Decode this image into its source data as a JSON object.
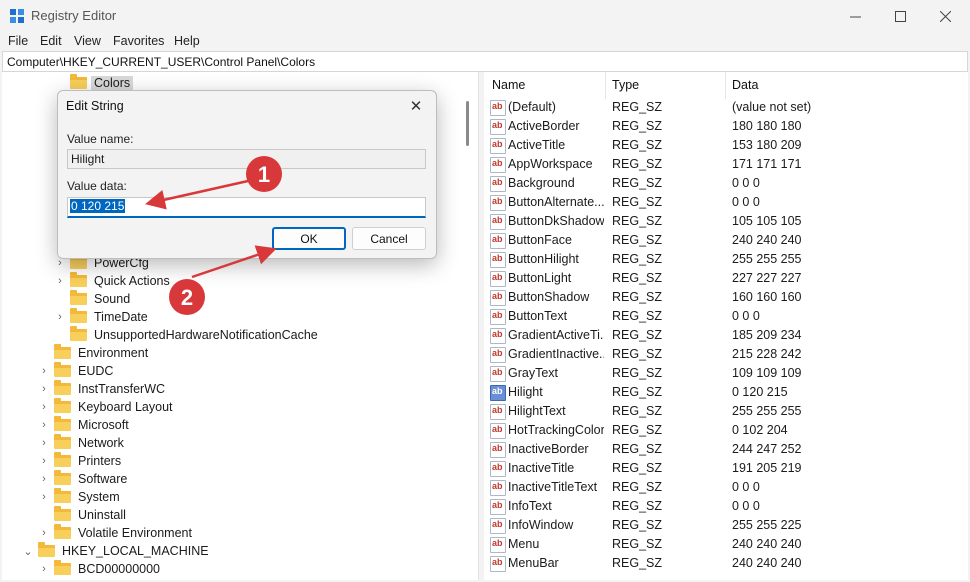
{
  "window": {
    "title": "Registry Editor",
    "controls": [
      "—",
      "☐",
      "✕"
    ]
  },
  "menu": [
    "File",
    "Edit",
    "View",
    "Favorites",
    "Help"
  ],
  "address": "Computer\\HKEY_CURRENT_USER\\Control Panel\\Colors",
  "tree": [
    {
      "label": "Colors",
      "chev": "",
      "selected": true
    },
    {
      "label": "PowerCfg",
      "chev": "›"
    },
    {
      "label": "Quick Actions",
      "chev": "›"
    },
    {
      "label": "Sound",
      "chev": ""
    },
    {
      "label": "TimeDate",
      "chev": "›"
    },
    {
      "label": "UnsupportedHardwareNotificationCache",
      "chev": ""
    },
    {
      "label": "Environment",
      "chev": ""
    },
    {
      "label": "EUDC",
      "chev": "›"
    },
    {
      "label": "InstTransferWC",
      "chev": "›"
    },
    {
      "label": "Keyboard Layout",
      "chev": "›"
    },
    {
      "label": "Microsoft",
      "chev": "›"
    },
    {
      "label": "Network",
      "chev": "›"
    },
    {
      "label": "Printers",
      "chev": "›"
    },
    {
      "label": "Software",
      "chev": "›"
    },
    {
      "label": "System",
      "chev": "›"
    },
    {
      "label": "Uninstall",
      "chev": ""
    },
    {
      "label": "Volatile Environment",
      "chev": "›"
    },
    {
      "label": "HKEY_LOCAL_MACHINE",
      "chev": "⌄"
    },
    {
      "label": "BCD00000000",
      "chev": "›"
    }
  ],
  "columns": {
    "name": "Name",
    "type": "Type",
    "data": "Data"
  },
  "values": [
    {
      "name": "(Default)",
      "type": "REG_SZ",
      "data": "(value not set)"
    },
    {
      "name": "ActiveBorder",
      "type": "REG_SZ",
      "data": "180 180 180"
    },
    {
      "name": "ActiveTitle",
      "type": "REG_SZ",
      "data": "153 180 209"
    },
    {
      "name": "AppWorkspace",
      "type": "REG_SZ",
      "data": "171 171 171"
    },
    {
      "name": "Background",
      "type": "REG_SZ",
      "data": "0 0 0"
    },
    {
      "name": "ButtonAlternate...",
      "type": "REG_SZ",
      "data": "0 0 0"
    },
    {
      "name": "ButtonDkShadow",
      "type": "REG_SZ",
      "data": "105 105 105"
    },
    {
      "name": "ButtonFace",
      "type": "REG_SZ",
      "data": "240 240 240"
    },
    {
      "name": "ButtonHilight",
      "type": "REG_SZ",
      "data": "255 255 255"
    },
    {
      "name": "ButtonLight",
      "type": "REG_SZ",
      "data": "227 227 227"
    },
    {
      "name": "ButtonShadow",
      "type": "REG_SZ",
      "data": "160 160 160"
    },
    {
      "name": "ButtonText",
      "type": "REG_SZ",
      "data": "0 0 0"
    },
    {
      "name": "GradientActiveTi...",
      "type": "REG_SZ",
      "data": "185 209 234"
    },
    {
      "name": "GradientInactive...",
      "type": "REG_SZ",
      "data": "215 228 242"
    },
    {
      "name": "GrayText",
      "type": "REG_SZ",
      "data": "109 109 109"
    },
    {
      "name": "Hilight",
      "type": "REG_SZ",
      "data": "0 120 215",
      "selected": true
    },
    {
      "name": "HilightText",
      "type": "REG_SZ",
      "data": "255 255 255"
    },
    {
      "name": "HotTrackingColor",
      "type": "REG_SZ",
      "data": "0 102 204"
    },
    {
      "name": "InactiveBorder",
      "type": "REG_SZ",
      "data": "244 247 252"
    },
    {
      "name": "InactiveTitle",
      "type": "REG_SZ",
      "data": "191 205 219"
    },
    {
      "name": "InactiveTitleText",
      "type": "REG_SZ",
      "data": "0 0 0"
    },
    {
      "name": "InfoText",
      "type": "REG_SZ",
      "data": "0 0 0"
    },
    {
      "name": "InfoWindow",
      "type": "REG_SZ",
      "data": "255 255 225"
    },
    {
      "name": "Menu",
      "type": "REG_SZ",
      "data": "240 240 240"
    },
    {
      "name": "MenuBar",
      "type": "REG_SZ",
      "data": "240 240 240"
    }
  ],
  "dialog": {
    "title": "Edit String",
    "close": "✕",
    "value_name_label": "Value name:",
    "value_name": "Hilight",
    "value_data_label": "Value data:",
    "value_data": "0 120 215",
    "ok": "OK",
    "cancel": "Cancel"
  },
  "annotations": {
    "step1": "1",
    "step2": "2",
    "color": "#d9383a"
  }
}
